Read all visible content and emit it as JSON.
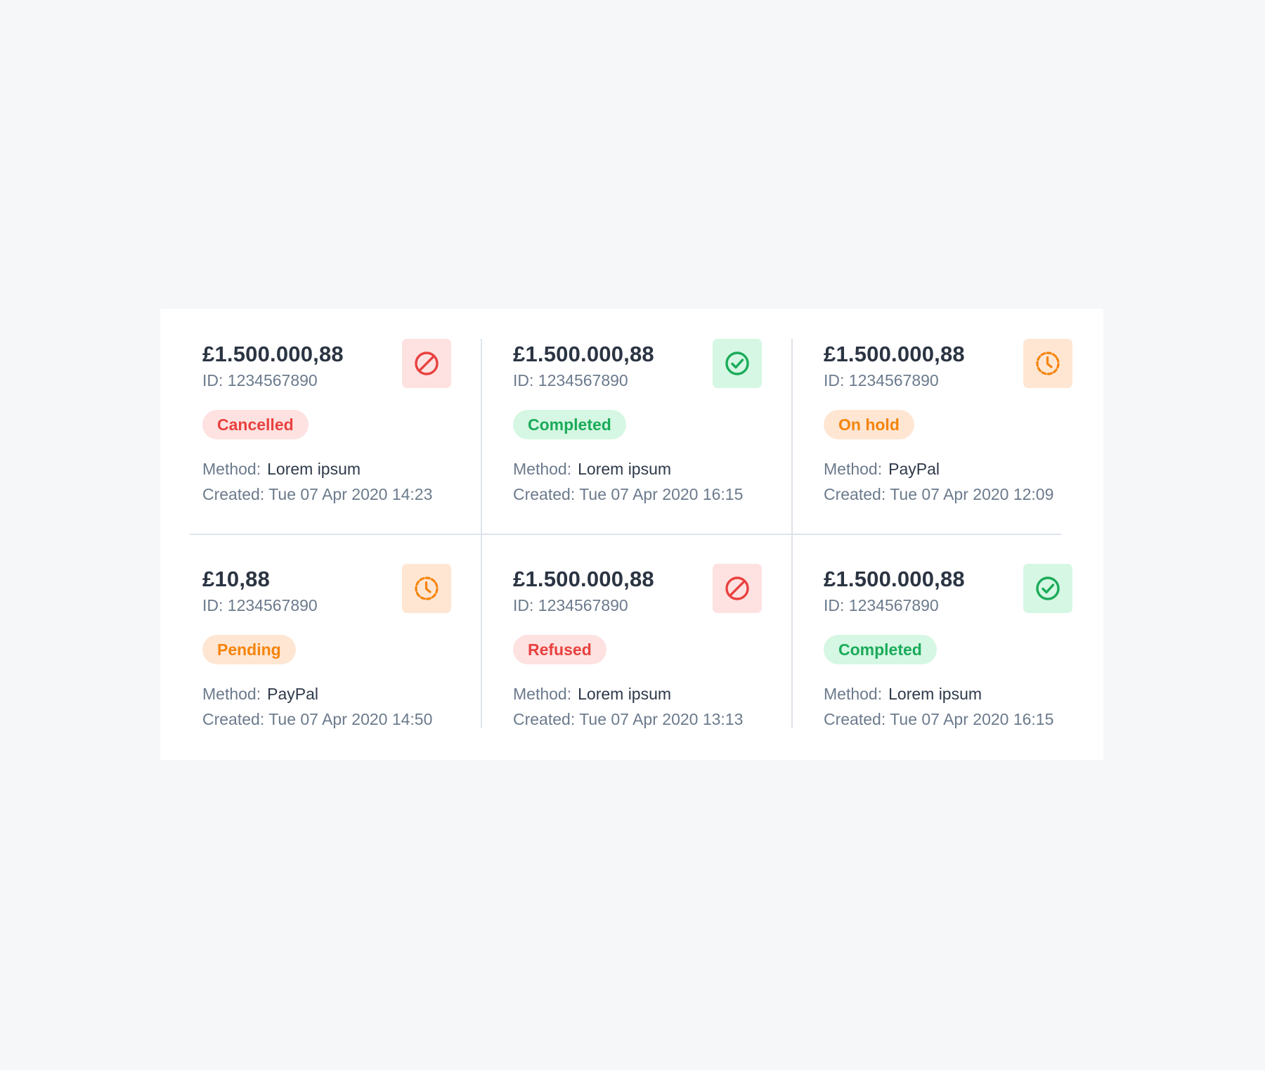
{
  "colors": {
    "page_background": "#f6f7f9",
    "panel_background": "#ffffff",
    "divider": "#dde3ea",
    "text_primary": "#2b3442",
    "text_secondary": "#6b7a8c",
    "status": {
      "cancelled": {
        "text": "#e8413f",
        "bg": "#fde2e1",
        "icon": "#e8413f"
      },
      "completed": {
        "text": "#1bab5a",
        "bg": "#d5f7e3",
        "icon": "#1bab5a"
      },
      "pending": {
        "text": "#f5840c",
        "bg": "#fee6d3",
        "icon": "#f5840c"
      }
    }
  },
  "labels": {
    "method": "Method:",
    "created": "Created:"
  },
  "transactions": [
    {
      "amount": "£1.500.000,88",
      "id": "ID: 1234567890",
      "status": "Cancelled",
      "status_tone": "cancelled",
      "icon": "ban-icon",
      "method": "Lorem ipsum",
      "created": "Tue 07 Apr 2020 14:23"
    },
    {
      "amount": "£1.500.000,88",
      "id": "ID: 1234567890",
      "status": "Completed",
      "status_tone": "completed",
      "icon": "check-circle-icon",
      "method": "Lorem ipsum",
      "created": "Tue 07 Apr 2020 16:15"
    },
    {
      "amount": "£1.500.000,88",
      "id": "ID: 1234567890",
      "status": "On hold",
      "status_tone": "pending",
      "icon": "clock-dashed-icon",
      "method": "PayPal",
      "created": "Tue 07 Apr 2020 12:09"
    },
    {
      "amount": "£10,88",
      "id": "ID: 1234567890",
      "status": "Pending",
      "status_tone": "pending",
      "icon": "clock-dashed-icon",
      "method": "PayPal",
      "created": "Tue 07 Apr 2020 14:50"
    },
    {
      "amount": "£1.500.000,88",
      "id": "ID: 1234567890",
      "status": "Refused",
      "status_tone": "cancelled",
      "icon": "ban-icon",
      "method": "Lorem ipsum",
      "created": "Tue 07 Apr 2020 13:13"
    },
    {
      "amount": "£1.500.000,88",
      "id": "ID: 1234567890",
      "status": "Completed",
      "status_tone": "completed",
      "icon": "check-circle-icon",
      "method": "Lorem ipsum",
      "created": "Tue 07 Apr 2020 16:15"
    }
  ]
}
